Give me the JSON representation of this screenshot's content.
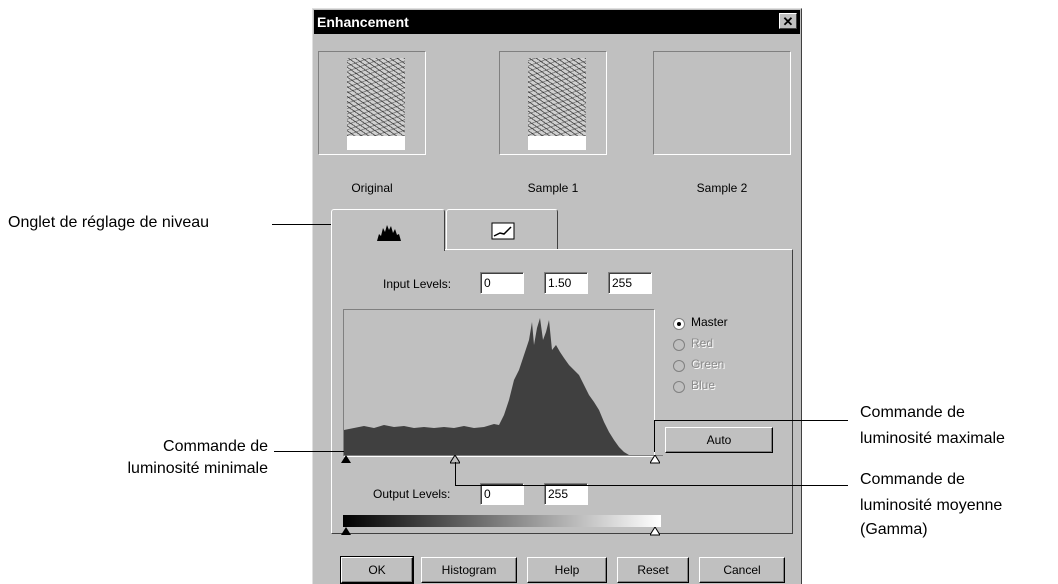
{
  "dialog": {
    "title": "Enhancement",
    "close_glyph": "✕"
  },
  "thumbnails": [
    {
      "label": "Original"
    },
    {
      "label": "Sample 1"
    },
    {
      "label": "Sample 2"
    }
  ],
  "tabs": [
    {
      "icon": "histogram-icon"
    },
    {
      "icon": "curve-icon"
    }
  ],
  "levels": {
    "input_label": "Input Levels:",
    "input_min": "0",
    "input_gamma": "1.50",
    "input_max": "255",
    "output_label": "Output Levels:",
    "output_min": "0",
    "output_max": "255"
  },
  "channels": [
    {
      "label": "Master",
      "selected": true,
      "enabled": true
    },
    {
      "label": "Red",
      "selected": false,
      "enabled": false
    },
    {
      "label": "Green",
      "selected": false,
      "enabled": false
    },
    {
      "label": "Blue",
      "selected": false,
      "enabled": false
    }
  ],
  "auto_button": "Auto",
  "buttons": {
    "ok": "OK",
    "histogram": "Histogram",
    "help": "Help",
    "reset": "Reset",
    "cancel": "Cancel"
  },
  "annotations": {
    "tab": "Onglet de réglage de niveau",
    "min_line1": "Commande de",
    "min_line2": "luminosité minimale",
    "max_line1": "Commande de",
    "max_line2": "luminosité maximale",
    "mid_line1": "Commande de",
    "mid_line2": "luminosité moyenne",
    "mid_line3": "(Gamma)"
  },
  "colors": {
    "dialog_bg": "#c0c0c0",
    "histogram_fill": "#404040"
  }
}
